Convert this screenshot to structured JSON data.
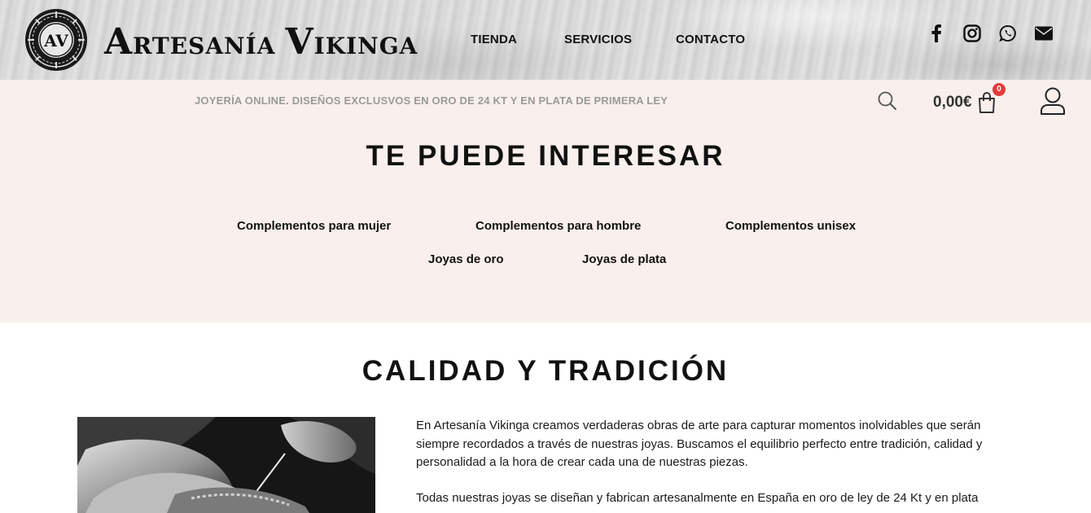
{
  "header": {
    "brand_first_initial": "A",
    "brand_first_rest": "RTESANÍA",
    "brand_second_initial": "V",
    "brand_second_rest": "IKINGA",
    "logo_monogram": "AV",
    "nav": [
      "TIENDA",
      "SERVICIOS",
      "CONTACTO"
    ],
    "social_icons": [
      "facebook-icon",
      "instagram-icon",
      "whatsapp-icon",
      "email-icon"
    ]
  },
  "subheader": {
    "tagline": "JOYERÍA ONLINE. DISEÑOS EXCLUSVOS EN ORO DE 24 KT Y EN PLATA DE PRIMERA LEY",
    "cart_total": "0,00€",
    "cart_count": "0"
  },
  "interest": {
    "heading": "TE PUEDE INTERESAR",
    "links": [
      "Complementos para mujer",
      "Complementos para hombre",
      "Complementos unisex",
      "Joyas de oro",
      "Joyas de plata"
    ]
  },
  "quality": {
    "heading": "CALIDAD Y TRADICIÓN",
    "paragraph1": "En Artesanía Vikinga creamos verdaderas obras de arte para capturar momentos inolvidables que serán siempre recordados a través de nuestras joyas. Buscamos el equilibrio perfecto entre tradición, calidad y personalidad a la hora de crear cada una de nuestras piezas.",
    "paragraph2": "Todas nuestras joyas se diseñan y fabrican artesanalmente en España en oro de ley de 24 Kt y en plata"
  },
  "colors": {
    "band_background": "#f9f0ee",
    "badge": "#e53a3a",
    "tagline": "#9a9a9a"
  }
}
